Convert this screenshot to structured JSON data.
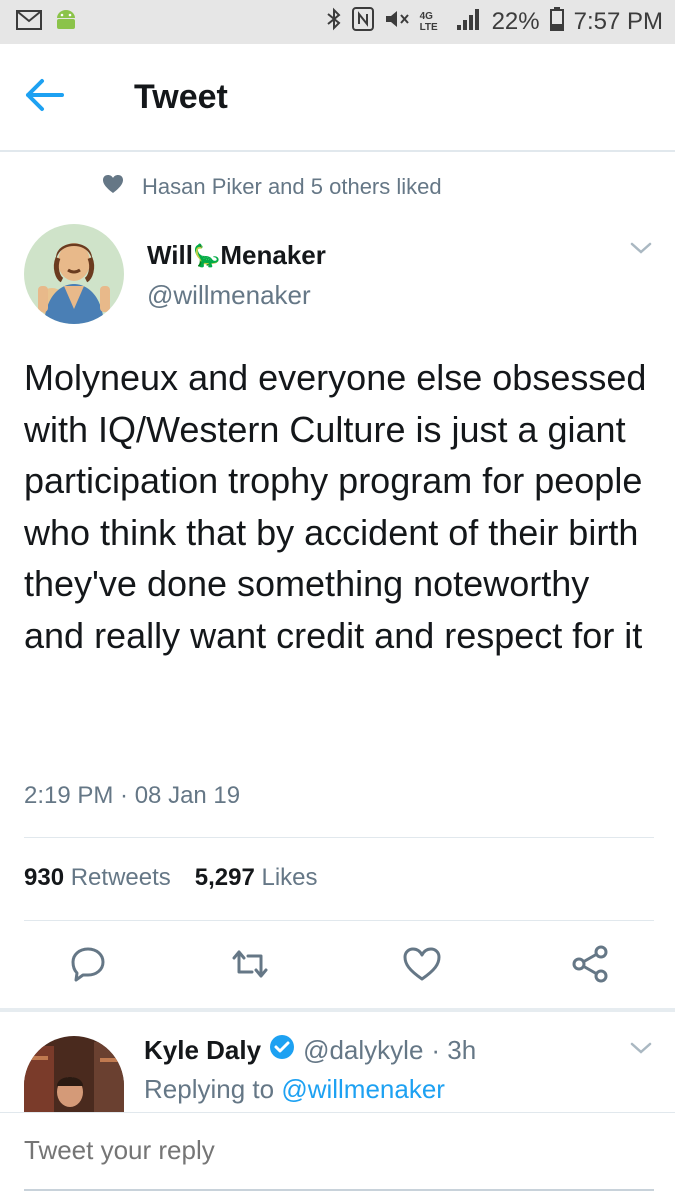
{
  "status_bar": {
    "battery": "22%",
    "time": "7:57 PM",
    "network": "4G LTE",
    "icons": [
      "gmail-icon",
      "android-icon",
      "bluetooth-icon",
      "nfc-icon",
      "mute-icon",
      "signal-icon",
      "battery-icon"
    ]
  },
  "header": {
    "title": "Tweet",
    "back_icon": "back-arrow-icon"
  },
  "liked": {
    "text": "Hasan Piker and 5 others liked"
  },
  "tweet": {
    "author_name_first": "Will",
    "author_name_emoji": "🦕",
    "author_name_last": "Menaker",
    "handle": "@willmenaker",
    "text": "Molyneux and everyone else obsessed with IQ/Western Culture is just a giant participation trophy program for people who think that by accident of their birth they've done something noteworthy and really want credit and respect for it",
    "timestamp": "2:19 PM · 08 Jan 19",
    "retweets_count": "930",
    "retweets_label": "Retweets",
    "likes_count": "5,297",
    "likes_label": "Likes"
  },
  "reply": {
    "name": "Kyle Daly",
    "handle": "@dalykyle",
    "time": "· 3h",
    "replying_prefix": "Replying to",
    "replying_to": "@willmenaker"
  },
  "compose": {
    "placeholder": "Tweet your reply"
  },
  "colors": {
    "accent": "#1da1f2",
    "muted": "#657786",
    "text": "#14171a",
    "divider": "#e1e8ed"
  }
}
